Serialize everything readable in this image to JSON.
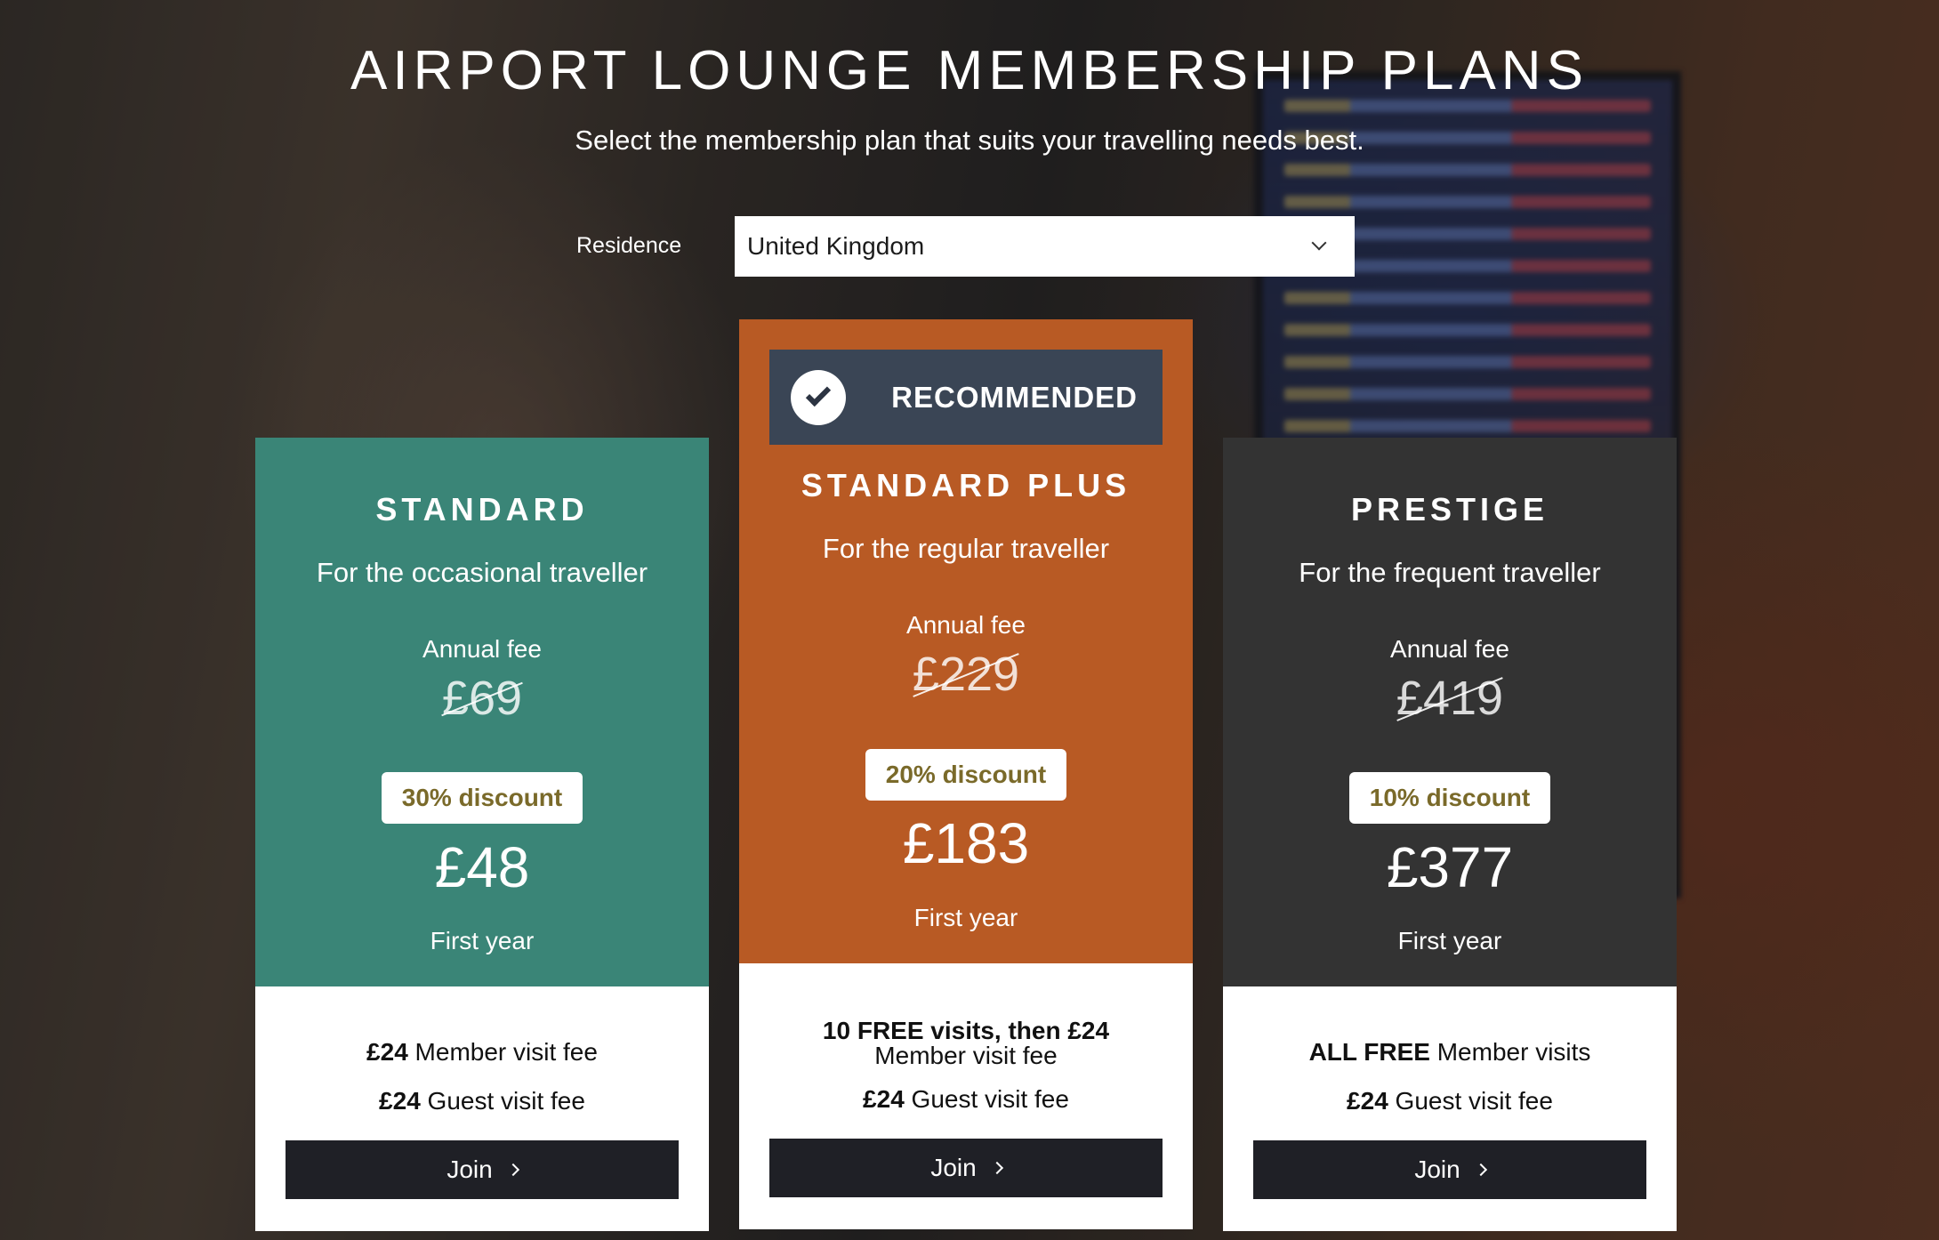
{
  "page": {
    "title": "AIRPORT LOUNGE MEMBERSHIP PLANS",
    "subtitle": "Select the membership plan that suits your travelling needs best."
  },
  "residence": {
    "label": "Residence",
    "selected": "United Kingdom"
  },
  "plans": [
    {
      "name": "STANDARD",
      "tagline": "For the occasional traveller",
      "fee_label": "Annual fee",
      "old_price": "£69",
      "discount": "30% discount",
      "price": "£48",
      "price_note": "First year",
      "member_visit_bold": "£24",
      "member_visit_text": " Member visit fee",
      "guest_visit_bold": "£24",
      "guest_visit_text": " Guest visit fee",
      "join_label": "Join",
      "color": "#3a8577"
    },
    {
      "name": "STANDARD PLUS",
      "recommended_label": "RECOMMENDED",
      "tagline": "For the regular traveller",
      "fee_label": "Annual fee",
      "old_price": "£229",
      "discount": "20% discount",
      "price": "£183",
      "price_note": "First year",
      "member_visit_bold": "10 FREE visits, then £24",
      "member_visit_text": " Member visit fee",
      "guest_visit_bold": "£24",
      "guest_visit_text": " Guest visit fee",
      "join_label": "Join",
      "color": "#b85a24"
    },
    {
      "name": "PRESTIGE",
      "tagline": "For the frequent traveller",
      "fee_label": "Annual fee",
      "old_price": "£419",
      "discount": "10% discount",
      "price": "£377",
      "price_note": "First year",
      "member_visit_bold": "ALL FREE",
      "member_visit_text": " Member visits",
      "guest_visit_bold": "£24",
      "guest_visit_text": " Guest visit fee",
      "join_label": "Join",
      "color": "#333333"
    }
  ]
}
